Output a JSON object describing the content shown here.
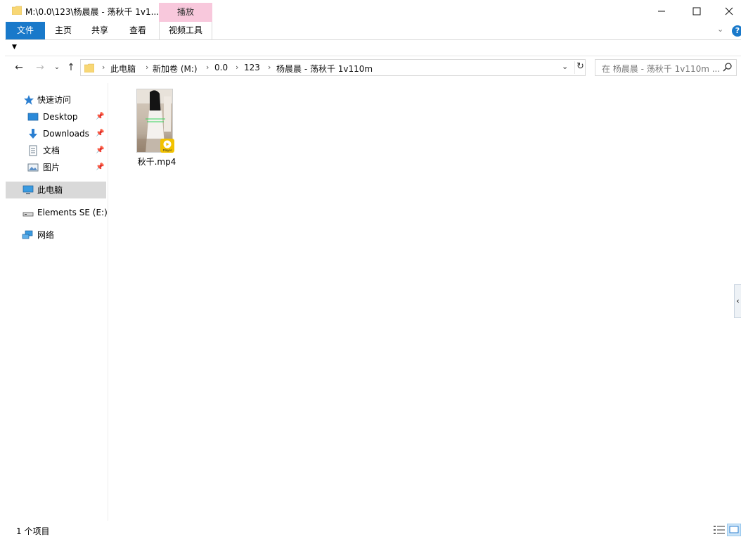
{
  "window": {
    "title": "M:\\0.0\\123\\杨晨晨 - 荡秋千 1v1...",
    "context_tab_group": "播放"
  },
  "ribbon": {
    "tabs": [
      "文件",
      "主页",
      "共享",
      "查看",
      "视频工具"
    ]
  },
  "address": {
    "breadcrumbs": [
      "此电脑",
      "新加卷 (M:)",
      "0.0",
      "123",
      "杨晨晨 - 荡秋千 1v110m"
    ]
  },
  "search": {
    "placeholder": "在 杨晨晨 - 荡秋千 1v110m ..."
  },
  "navpane": {
    "quick_access": "快速访问",
    "pinned": [
      "Desktop",
      "Downloads",
      "文档",
      "图片"
    ],
    "this_pc": "此电脑",
    "drive": "Elements SE (E:)",
    "network": "网络"
  },
  "files": [
    {
      "name": "秋千.mp4",
      "badge": "Player"
    }
  ],
  "status": {
    "item_count": "1 个项目"
  },
  "colors": {
    "file_tab": "#1979ca",
    "context_tab": "#f8c8dc",
    "selected_nav": "#d9d9d9"
  }
}
